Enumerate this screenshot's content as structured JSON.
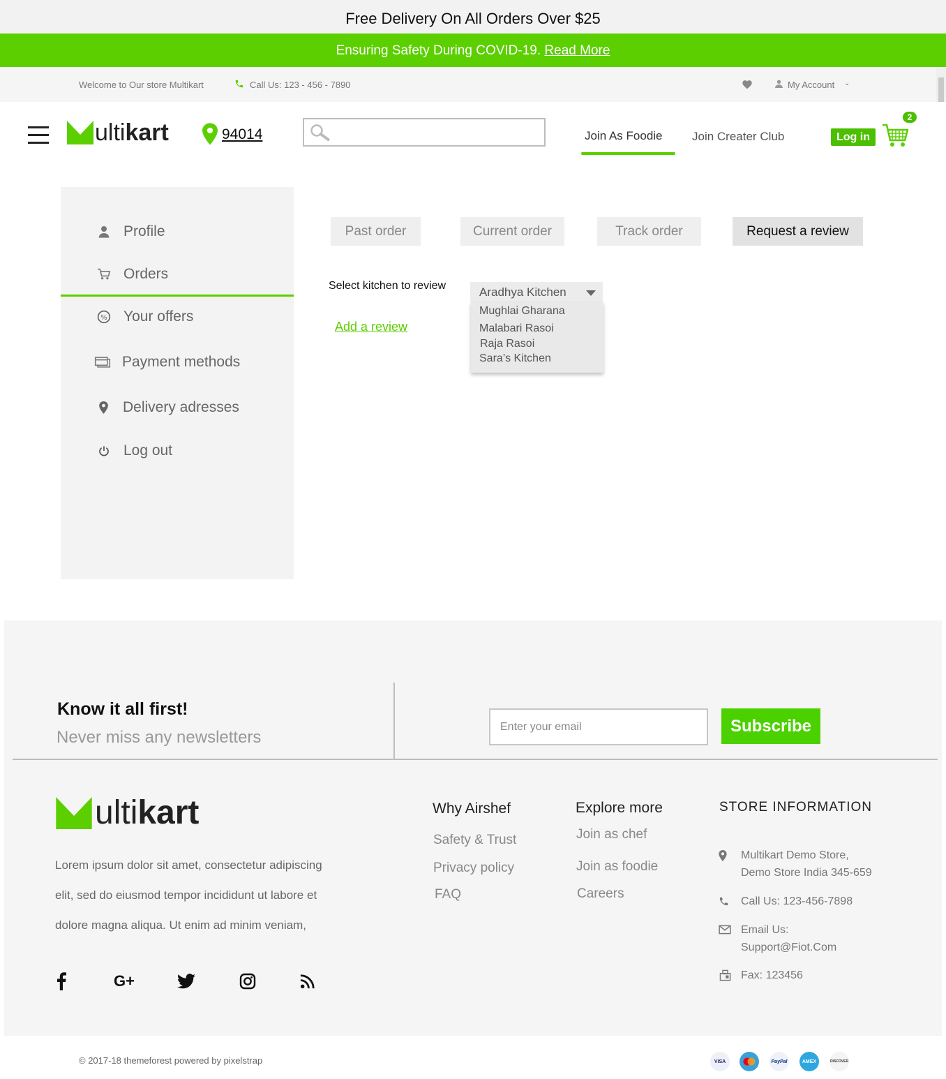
{
  "promo": {
    "text": "Free Delivery On All Orders Over $25"
  },
  "covid": {
    "text": "Ensuring Safety During COVID-19.",
    "link": "Read More"
  },
  "util": {
    "welcome": "Welcome to Our store Multikart",
    "call": "Call Us: 123 - 456 - 7890",
    "account": "My Account"
  },
  "header": {
    "logo_m": "M",
    "logo_rest": "ulti",
    "logo_bold": "kart",
    "pincode": "94014",
    "search_placeholder": "",
    "nav": [
      "Join As Foodie",
      "Join Creater Club"
    ],
    "login": "Log in",
    "cart_count": "2"
  },
  "sidebar": {
    "items": [
      "Profile",
      "Orders",
      "Your offers",
      "Payment methods",
      "Delivery adresses",
      "Log out"
    ],
    "active": "Orders"
  },
  "tabs": [
    "Past order",
    "Current order",
    "Track order",
    "Request a review"
  ],
  "active_tab": "Request a review",
  "review": {
    "label": "Select kitchen to review",
    "selected": "Aradhya Kitchen",
    "options": [
      "Mughlai Gharana",
      "Malabari Rasoi",
      "Raja Rasoi",
      "Sara’s Kitchen"
    ],
    "add_link": "Add a review"
  },
  "newsletter": {
    "title": "Know it all first!",
    "subtitle": "Never miss any newsletters",
    "placeholder": "Enter your email",
    "button": "Subscribe"
  },
  "footer": {
    "about": "Lorem ipsum dolor sit amet, consectetur adipiscing elit, sed do eiusmod tempor incididunt ut labore et dolore magna aliqua. Ut enim ad minim veniam,",
    "about_lines": [
      "Lorem ipsum dolor sit amet, consectetur adipiscing",
      "elit, sed do eiusmod tempor incididunt ut labore et",
      "dolore magna aliqua. Ut enim ad minim veniam,"
    ],
    "why": {
      "title": "Why Airshef",
      "links": [
        "Safety & Trust",
        "Privacy policy",
        "FAQ"
      ]
    },
    "explore": {
      "title": "Explore more",
      "links": [
        "Join as chef",
        "Join as foodie",
        "Careers"
      ]
    },
    "store": {
      "title": "STORE INFORMATION",
      "address1": "Multikart Demo Store,",
      "address2": "Demo Store India 345-659",
      "call": "Call Us: 123-456-7898",
      "email1": "Email Us:",
      "email2": "Support@Fiot.Com",
      "fax": "Fax: 123456"
    },
    "social": [
      "facebook-icon",
      "google-plus-icon",
      "twitter-icon",
      "instagram-icon",
      "rss-icon"
    ],
    "copyright": "© 2017-18 themeforest powered by pixelstrap",
    "payments": [
      "VISA",
      "MasterCard",
      "PayPal",
      "American Express",
      "DISCOVER"
    ]
  },
  "colors": {
    "accent": "#5bcf00",
    "footer_bg": "#f5f5f5",
    "sidebar_bg": "#f3f3f3"
  }
}
